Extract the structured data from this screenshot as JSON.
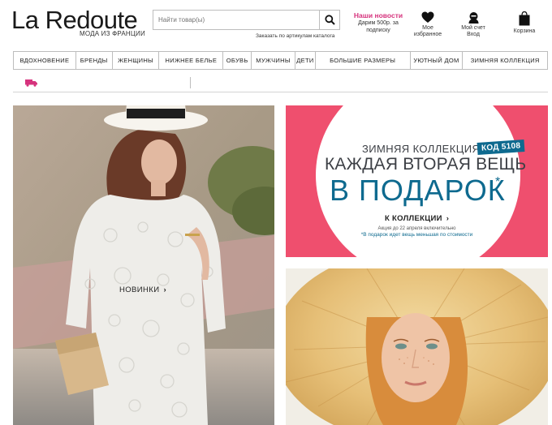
{
  "header": {
    "logo": "La Redoute",
    "tagline": "МОДА ИЗ ФРАНЦИИ",
    "search_placeholder": "Найти товар(ы)",
    "catalog_order": "Заказать по артикулам каталога",
    "promo_title": "Наши новости",
    "promo_line1": "Дарим 500р. за",
    "promo_line2": "подписку",
    "favorites_line1": "Мое",
    "favorites_line2": "избранное",
    "account_line1": "Мой счет",
    "account_line2": "Вход",
    "cart_label": "Корзина",
    "accent_color": "#d6337d"
  },
  "nav": {
    "items": [
      "ВДОХНОВЕНИЕ",
      "БРЕНДЫ",
      "ЖЕНЩИНЫ",
      "НИЖНЕЕ БЕЛЬЕ",
      "ОБУВЬ",
      "МУЖЧИНЫ",
      "ДЕТИ",
      "БОЛЬШИЕ РАЗМЕРЫ",
      "УЮТНЫЙ ДОМ",
      "ЗИМНЯЯ КОЛЛЕКЦИЯ"
    ]
  },
  "hero_left": {
    "link_label": "НОВИНКИ"
  },
  "banner": {
    "season": "ЗИМНЯЯ КОЛЛЕКЦИЯ",
    "code": "КОД 5108",
    "line1": "КАЖДАЯ ВТОРАЯ ВЕЩЬ",
    "line2": "В ПОДАРОК",
    "star": "*",
    "link": "К КОЛЛЕКЦИИ",
    "note1": "Акция до 22 апреля включительно",
    "note2": "*В подарок идет вещь меньшая по стоимости",
    "bg_color": "#ef4f6e",
    "accent_color": "#0e6a8f"
  },
  "icons": {
    "search": "search-icon",
    "favorites": "heart-icon",
    "account": "user-icon",
    "cart": "bag-icon",
    "delivery": "truck-icon",
    "chevron": "chevron-right-icon"
  }
}
